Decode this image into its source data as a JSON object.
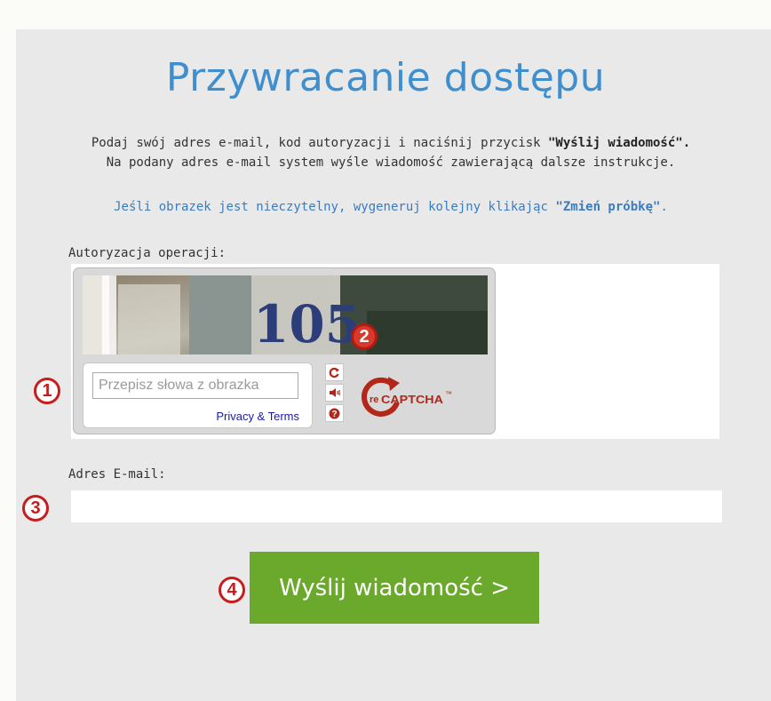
{
  "page": {
    "title": "Przywracanie dostępu",
    "desc_line1_pre": "Podaj swój adres e-mail, kod autoryzacji i naciśnij przycisk ",
    "desc_line1_bold": "\"Wyślij wiadomość\".",
    "desc_line2": "Na podany adres e-mail system wyśle wiadomość zawierającą dalsze instrukcje.",
    "hint_pre": "Jeśli obrazek jest nieczytelny, wygeneruj kolejny klikając ",
    "hint_bold": "\"Zmień próbkę\"",
    "hint_post": "."
  },
  "captcha": {
    "label": "Autoryzacja operacji:",
    "image_text": "105",
    "input_placeholder": "Przepisz słowa z obrazka",
    "privacy_link": "Privacy & Terms",
    "logo_re": "re",
    "logo_name": "CAPTCHA",
    "logo_tm": "™"
  },
  "email": {
    "label": "Adres E-mail:",
    "value": ""
  },
  "submit": {
    "label": "Wyślij wiadomość >"
  },
  "annotations": [
    "1",
    "2",
    "3",
    "4"
  ],
  "colors": {
    "title": "#3f8fcf",
    "link": "#3a7cbf",
    "button": "#6aa92b",
    "annotation": "#c81d1d"
  }
}
